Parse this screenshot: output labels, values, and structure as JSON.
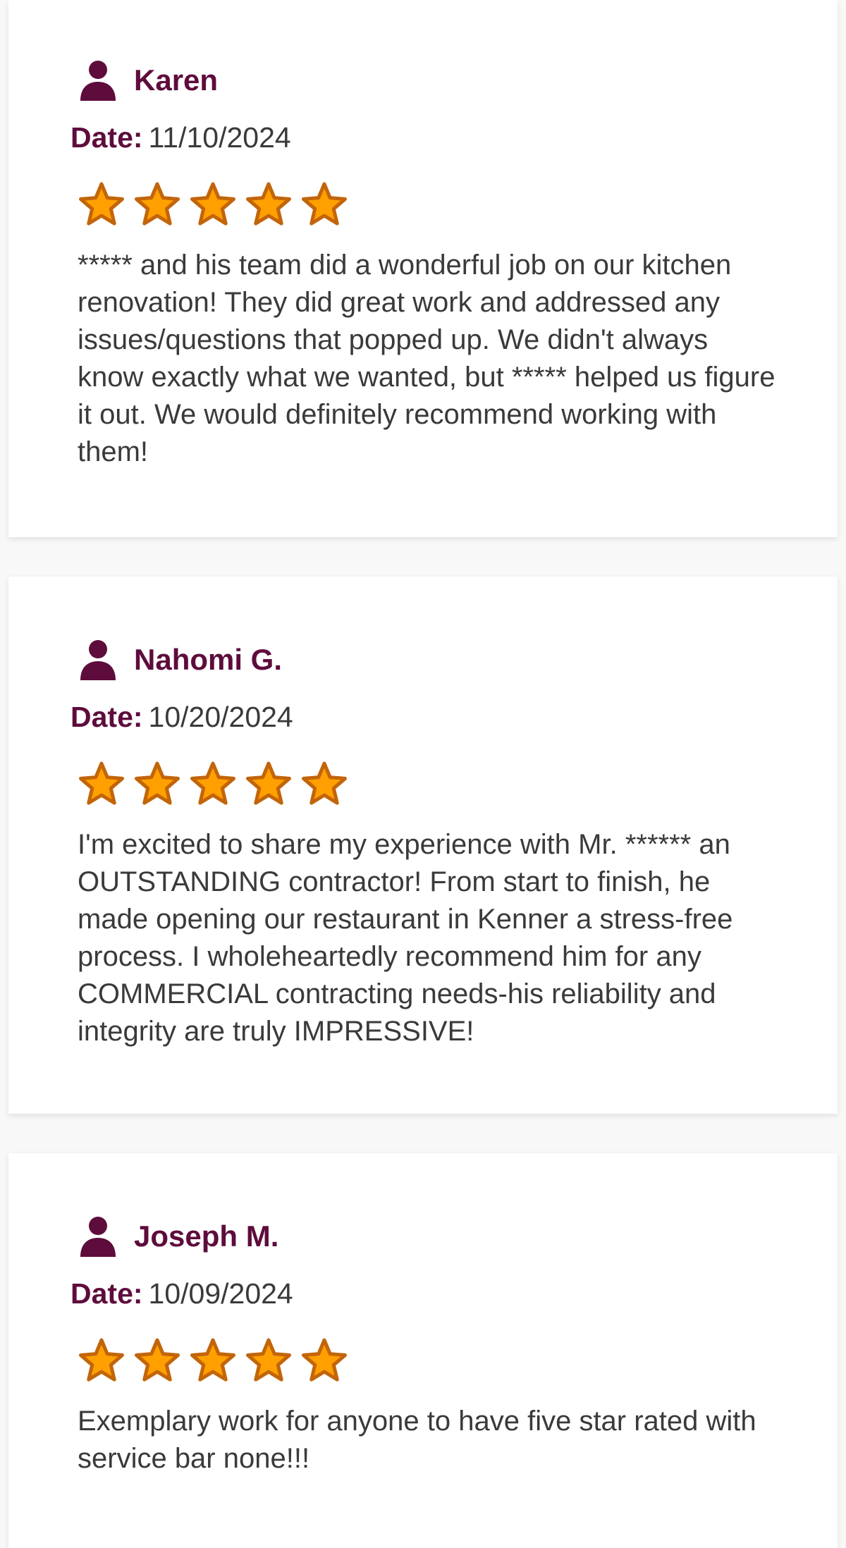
{
  "date_label": "Date:",
  "colors": {
    "accent": "#5e0c3c",
    "star_fill": "#ffa000",
    "star_outline": "#c2650a",
    "text": "#3a3a3a"
  },
  "reviews": [
    {
      "name": "Karen",
      "date": "11/10/2024",
      "rating": 5,
      "text": "***** and his team did a wonderful job on our kitchen renovation! They did great work and addressed any issues/questions that popped up. We didn't always know exactly what we wanted, but ***** helped us figure it out. We would definitely recommend working with them!"
    },
    {
      "name": "Nahomi G.",
      "date": "10/20/2024",
      "rating": 5,
      "text": "I'm excited to share my experience with Mr. ****** an OUTSTANDING contractor! From start to finish, he made opening our restaurant in Kenner a stress-free process. I wholeheartedly recommend him for any COMMERCIAL contracting needs-his reliability and integrity are truly IMPRESSIVE!"
    },
    {
      "name": "Joseph M.",
      "date": "10/09/2024",
      "rating": 5,
      "text": "Exemplary work for anyone to have five star rated with service bar none!!!"
    }
  ]
}
